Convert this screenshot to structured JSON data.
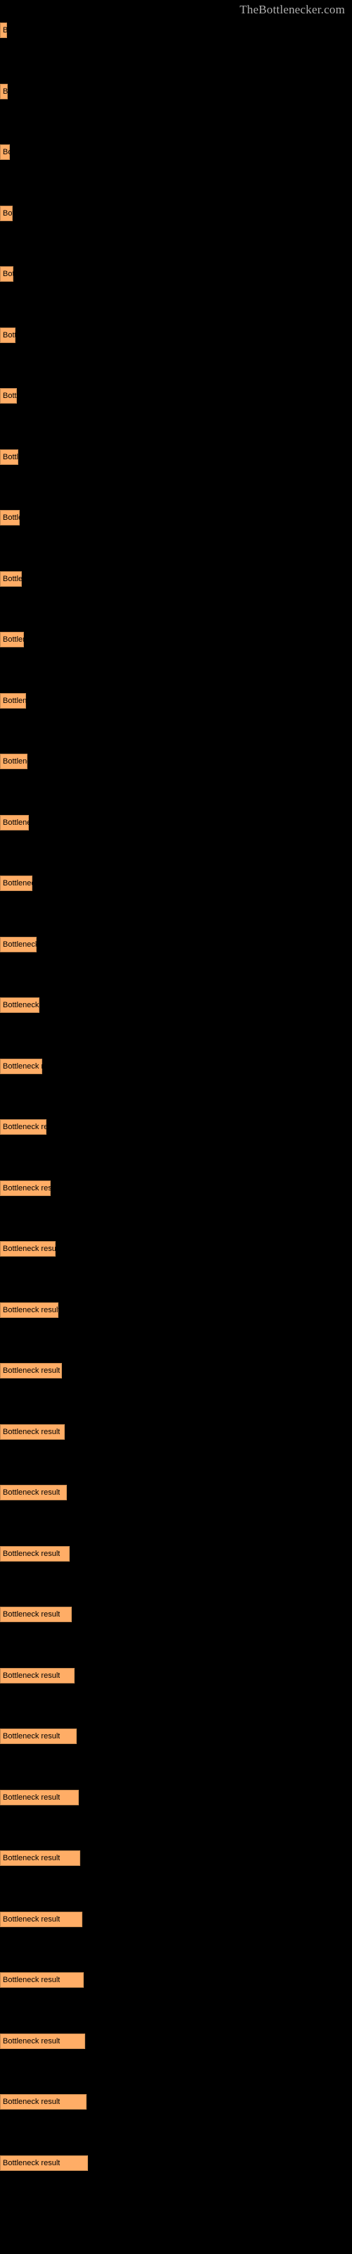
{
  "site": {
    "title": "TheBottlenecker.com"
  },
  "chart_data": {
    "type": "bar",
    "orientation": "horizontal",
    "title": "TheBottlenecker.com",
    "xlabel": "",
    "ylabel": "",
    "grid": false,
    "legend": null,
    "background": "#000000",
    "bar_color": "#ffad66",
    "bar_border_color": "#c98a50",
    "label_color": "#000000",
    "bar_label_text": "Bottleneck result",
    "categories": [
      "Bottleneck result",
      "Bottleneck result",
      "Bottleneck result",
      "Bottleneck result",
      "Bottleneck result",
      "Bottleneck result",
      "Bottleneck result",
      "Bottleneck result",
      "Bottleneck result",
      "Bottleneck result",
      "Bottleneck result",
      "Bottleneck result",
      "Bottleneck result",
      "Bottleneck result",
      "Bottleneck result",
      "Bottleneck result",
      "Bottleneck result",
      "Bottleneck result",
      "Bottleneck result",
      "Bottleneck result",
      "Bottleneck result",
      "Bottleneck result",
      "Bottleneck result",
      "Bottleneck result",
      "Bottleneck result",
      "Bottleneck result",
      "Bottleneck result",
      "Bottleneck result",
      "Bottleneck result",
      "Bottleneck result",
      "Bottleneck result",
      "Bottleneck result",
      "Bottleneck result",
      "Bottleneck result",
      "Bottleneck result",
      "Bottleneck result"
    ],
    "values": [
      8,
      9,
      11,
      14,
      15,
      18,
      19,
      21,
      22,
      25,
      27,
      30,
      31,
      33,
      37,
      42,
      45,
      48,
      53,
      58,
      64,
      67,
      71,
      74,
      77,
      80,
      83,
      86,
      88,
      90,
      92,
      94,
      96,
      97,
      99,
      100
    ],
    "xlim": [
      0,
      100
    ],
    "bar_pixel_widths": [
      10,
      11,
      14,
      18,
      19,
      22,
      24,
      26,
      28,
      31,
      34,
      37,
      39,
      41,
      46,
      52,
      56,
      60,
      66,
      72,
      79,
      83,
      88,
      92,
      95,
      99,
      102,
      106,
      109,
      112,
      114,
      117,
      119,
      121,
      123,
      125
    ]
  }
}
